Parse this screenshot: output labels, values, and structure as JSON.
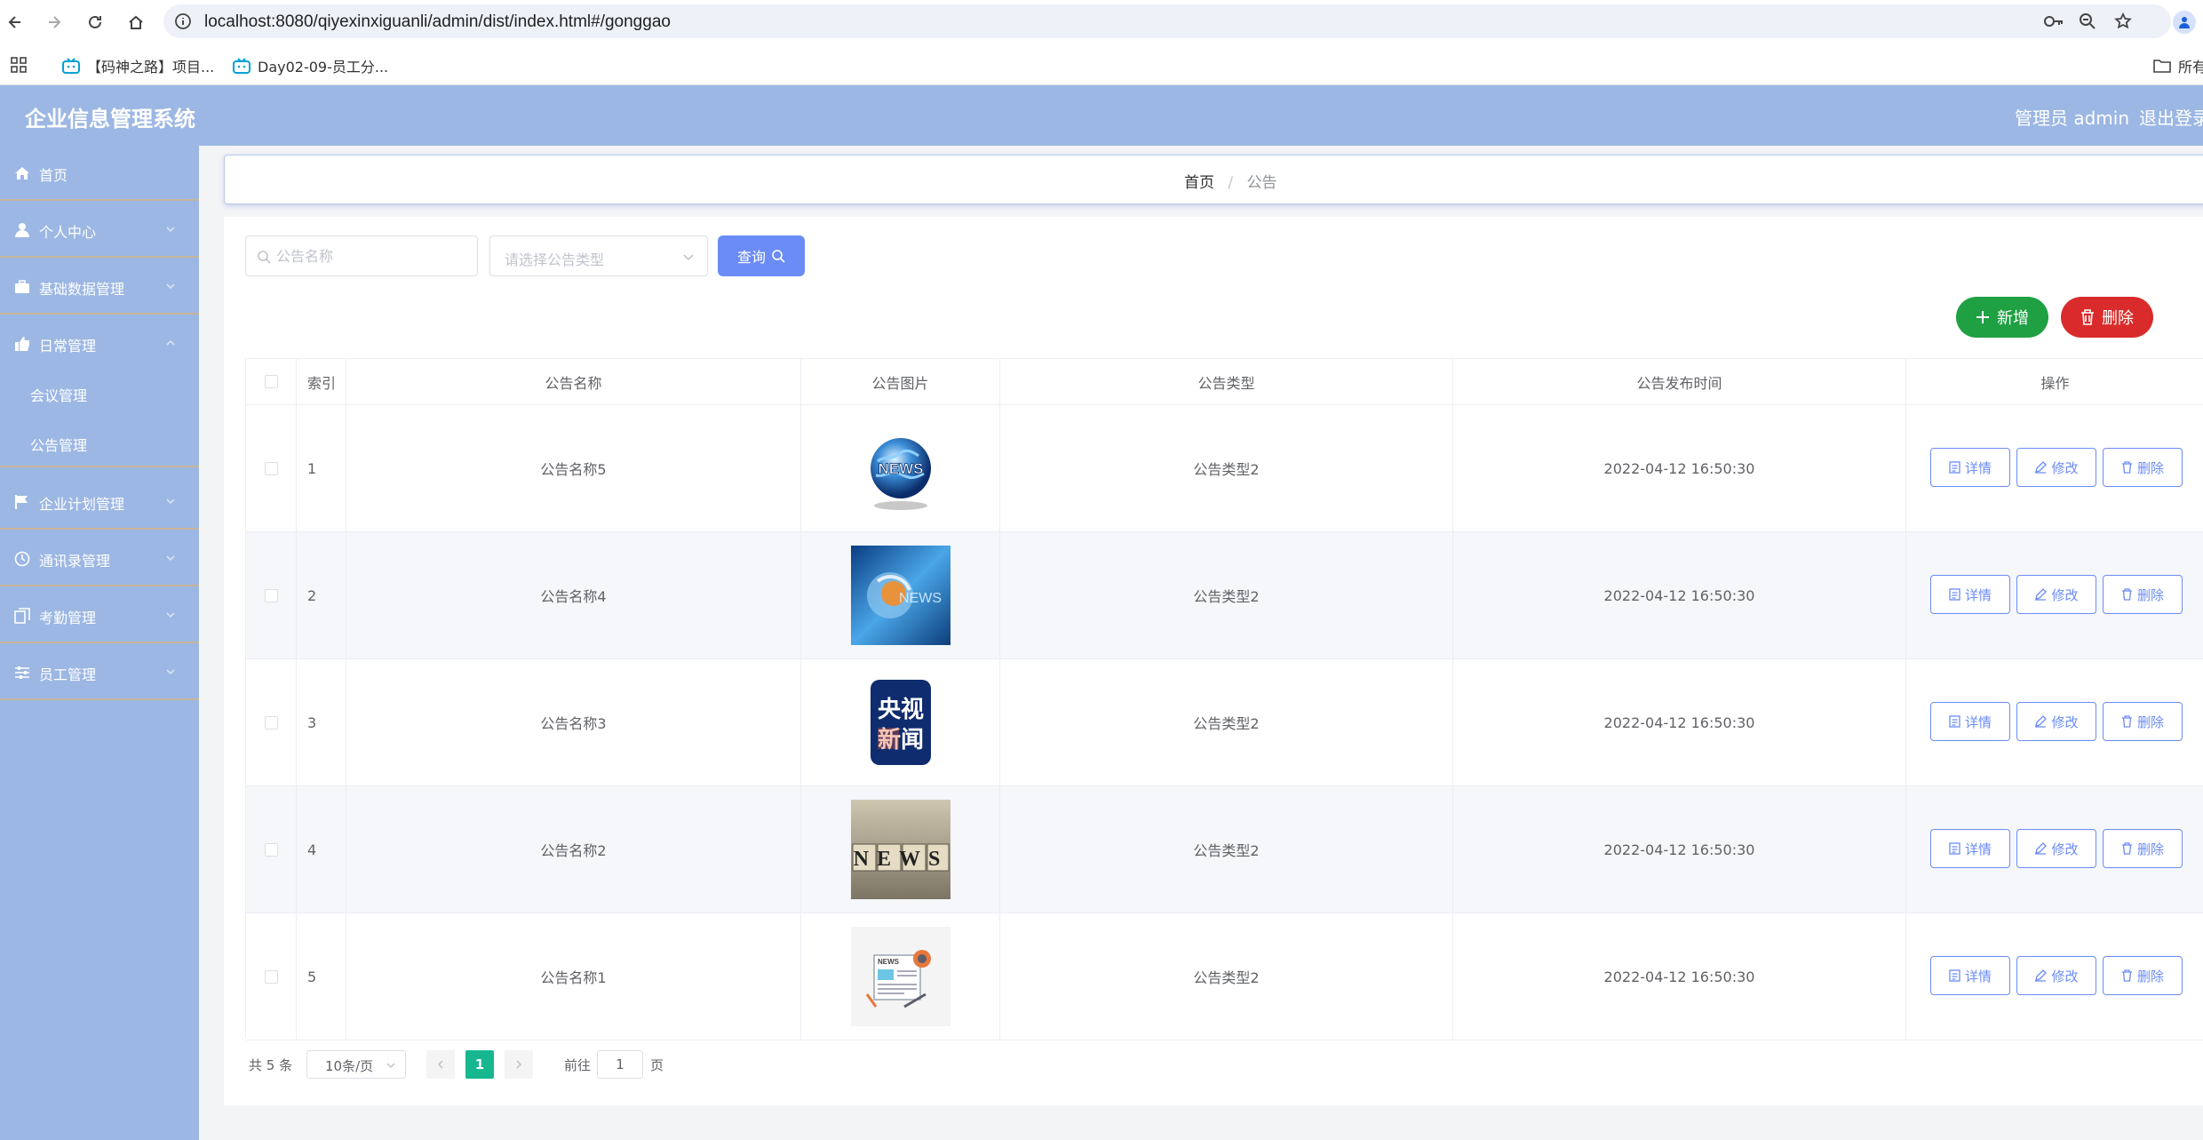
{
  "browser": {
    "url": "localhost:8080/qiyexinxiguanli/admin/dist/index.html#/gonggao",
    "bookmarks": [
      "【码神之路】项目...",
      "Day02-09-员工分..."
    ],
    "bookmarks_right": "所有"
  },
  "header": {
    "title": "企业信息管理系统",
    "user": "管理员 admin",
    "logout": "退出登录"
  },
  "sidebar": {
    "items": [
      {
        "label": "首页",
        "icon": "home-icon"
      },
      {
        "label": "个人中心",
        "icon": "user-icon"
      },
      {
        "label": "基础数据管理",
        "icon": "briefcase-icon"
      },
      {
        "label": "日常管理",
        "icon": "thumb-icon"
      },
      {
        "label": "企业计划管理",
        "icon": "flag-icon"
      },
      {
        "label": "通讯录管理",
        "icon": "clock-icon"
      },
      {
        "label": "考勤管理",
        "icon": "copy-icon"
      },
      {
        "label": "员工管理",
        "icon": "sliders-icon"
      }
    ],
    "sub_items": [
      "会议管理",
      "公告管理"
    ]
  },
  "breadcrumb": {
    "home": "首页",
    "current": "公告"
  },
  "search": {
    "name_placeholder": "公告名称",
    "type_placeholder": "请选择公告类型",
    "query_label": "查询"
  },
  "actions": {
    "add_label": "新增",
    "delete_label": "删除"
  },
  "table": {
    "columns": [
      "索引",
      "公告名称",
      "公告图片",
      "公告类型",
      "公告发布时间",
      "操作"
    ],
    "rows": [
      {
        "index": "1",
        "name": "公告名称5",
        "type": "公告类型2",
        "time": "2022-04-12 16:50:30",
        "image": "globe-news"
      },
      {
        "index": "2",
        "name": "公告名称4",
        "type": "公告类型2",
        "time": "2022-04-12 16:50:30",
        "image": "blue-news"
      },
      {
        "index": "3",
        "name": "公告名称3",
        "type": "公告类型2",
        "time": "2022-04-12 16:50:30",
        "image": "cctv-news"
      },
      {
        "index": "4",
        "name": "公告名称2",
        "type": "公告类型2",
        "time": "2022-04-12 16:50:30",
        "image": "blocks-news"
      },
      {
        "index": "5",
        "name": "公告名称1",
        "type": "公告类型2",
        "time": "2022-04-12 16:50:30",
        "image": "paper-news"
      }
    ],
    "row_actions": [
      "详情",
      "修改",
      "删除"
    ],
    "cctv_text": [
      "央视",
      "新闻"
    ],
    "news_text": "NEWS"
  },
  "pagination": {
    "total": "共 5 条",
    "page_size": "10条/页",
    "current_page": "1",
    "goto_label": "前往",
    "goto_value": "1",
    "page_unit": "页"
  },
  "colors": {
    "header_bg": "#9cb7e3",
    "primary": "#6b8cf7",
    "success": "#1fa043",
    "danger": "#d92b2b",
    "page_active": "#17b890"
  }
}
